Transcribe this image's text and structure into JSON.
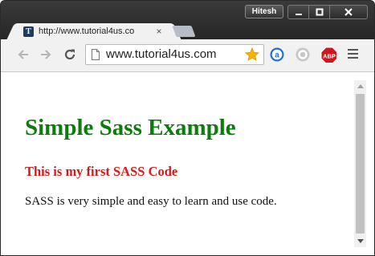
{
  "titlebar": {
    "user_name": "Hitesh"
  },
  "tab": {
    "title": "http://www.tutorial4us.co",
    "favicon_letter": "T",
    "close_glyph": "×"
  },
  "toolbar": {
    "url": "www.tutorial4us.com",
    "extensions": {
      "abp_label": "ABP"
    }
  },
  "page": {
    "heading": "Simple Sass Example",
    "subheading": "This is my first SASS Code",
    "paragraph": "SASS is very simple and easy to learn and use code."
  },
  "colors": {
    "heading": "#0a7d0a",
    "subheading": "#e11717",
    "star": "#f4b400",
    "abp": "#d3151b"
  },
  "icons": [
    "back-icon",
    "forward-icon",
    "reload-icon",
    "page-icon",
    "star-icon",
    "extension-a-icon",
    "extension-circle-icon",
    "adblock-plus-icon",
    "menu-icon"
  ]
}
